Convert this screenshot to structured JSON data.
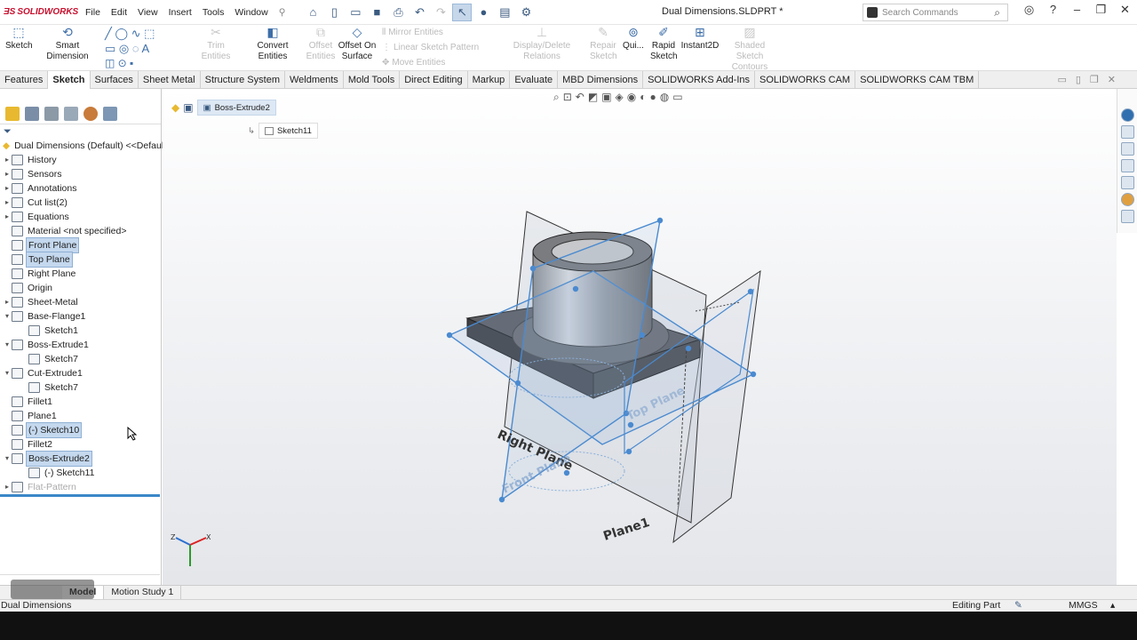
{
  "app": {
    "logo_text": "SOLIDWORKS",
    "document_title": "Dual Dimensions.SLDPRT *"
  },
  "menu": [
    "File",
    "Edit",
    "View",
    "Insert",
    "Tools",
    "Window"
  ],
  "search": {
    "placeholder": "Search Commands"
  },
  "ribbon": {
    "sketch": "Sketch",
    "smart_dimension": "Smart Dimension",
    "trim": "Trim Entities",
    "convert": "Convert Entities",
    "offset": "Offset Entities",
    "offset_surface": "Offset On Surface",
    "mirror": "Mirror Entities",
    "linear_pattern": "Linear Sketch Pattern",
    "move": "Move Entities",
    "display_delete": "Display/Delete Relations",
    "repair": "Repair Sketch",
    "quick": "Qui...",
    "rapid": "Rapid Sketch",
    "instant2d": "Instant2D",
    "shaded": "Shaded Sketch Contours"
  },
  "tabs": [
    "Features",
    "Sketch",
    "Surfaces",
    "Sheet Metal",
    "Structure System",
    "Weldments",
    "Mold Tools",
    "Direct Editing",
    "Markup",
    "Evaluate",
    "MBD Dimensions",
    "SOLIDWORKS Add-Ins",
    "SOLIDWORKS CAM",
    "SOLIDWORKS CAM TBM"
  ],
  "active_tab": "Sketch",
  "tree": {
    "root": "Dual Dimensions (Default) <<Default",
    "items": [
      {
        "label": "History",
        "arrow": true
      },
      {
        "label": "Sensors",
        "arrow": true
      },
      {
        "label": "Annotations",
        "arrow": true
      },
      {
        "label": "Cut list(2)",
        "arrow": true
      },
      {
        "label": "Equations",
        "arrow": true
      },
      {
        "label": "Material <not specified>",
        "arrow": false
      },
      {
        "label": "Front Plane",
        "arrow": false,
        "hl": true
      },
      {
        "label": "Top Plane",
        "arrow": false,
        "hl": true
      },
      {
        "label": "Right Plane",
        "arrow": false
      },
      {
        "label": "Origin",
        "arrow": false
      },
      {
        "label": "Sheet-Metal",
        "arrow": true
      },
      {
        "label": "Base-Flange1",
        "arrow": true,
        "open": true
      },
      {
        "label": "Sketch1",
        "indent": 1
      },
      {
        "label": "Boss-Extrude1",
        "arrow": true,
        "open": true
      },
      {
        "label": "Sketch7",
        "indent": 1
      },
      {
        "label": "Cut-Extrude1",
        "arrow": true,
        "open": true
      },
      {
        "label": "Sketch7",
        "indent": 1
      },
      {
        "label": "Fillet1",
        "arrow": false
      },
      {
        "label": "Plane1",
        "arrow": false
      },
      {
        "label": "(-) Sketch10",
        "arrow": false,
        "hl": true
      },
      {
        "label": "Fillet2",
        "arrow": false
      },
      {
        "label": "Boss-Extrude2",
        "arrow": true,
        "open": true,
        "hl": true
      },
      {
        "label": "(-) Sketch11",
        "indent": 1
      },
      {
        "label": "Flat-Pattern",
        "arrow": true,
        "dim": true
      }
    ]
  },
  "breadcrumb": {
    "feature": "Boss-Extrude2",
    "sketch": "Sketch11"
  },
  "planes": {
    "right": "Right Plane",
    "front": "Front Plane",
    "top": "Top Plane",
    "plane1": "Plane1"
  },
  "bottom_tabs": [
    "Model",
    "Motion Study 1"
  ],
  "status": {
    "left": "Dual Dimensions",
    "editing": "Editing Part",
    "units": "MMGS"
  },
  "colors": {
    "accent": "#3a87c8",
    "highlight": "#c4d8ee",
    "logo": "#c8102e"
  }
}
